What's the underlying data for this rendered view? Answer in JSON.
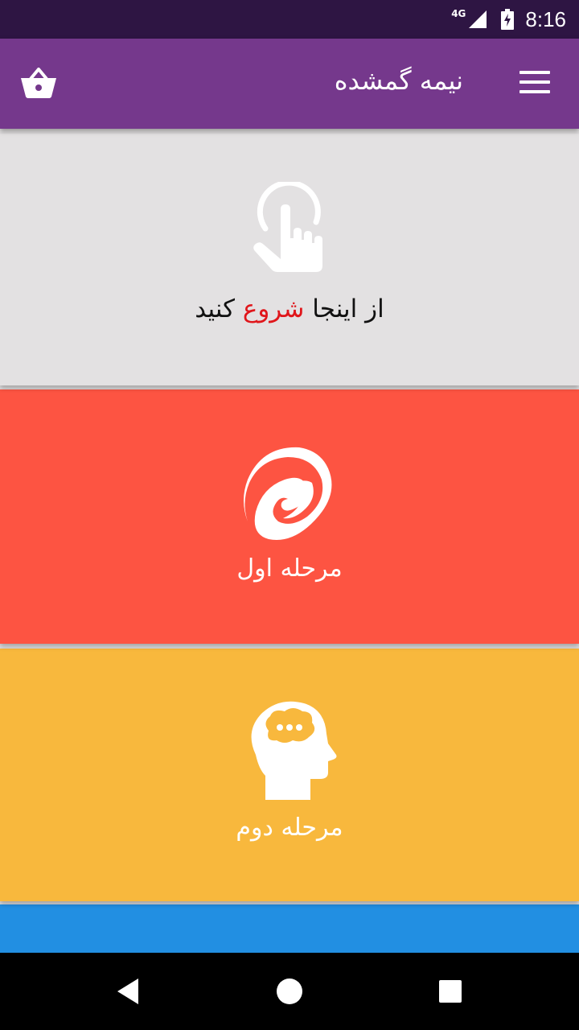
{
  "status_bar": {
    "network": "4G",
    "time": "8:16"
  },
  "app_bar": {
    "title": "نیمه گمشده"
  },
  "start_card": {
    "text_before": "از اینجا ",
    "text_highlight": "شروع",
    "text_after": " کنید",
    "highlight_color": "#e0161b",
    "icon": "touch-hand-icon"
  },
  "stages": [
    {
      "label": "مرحله اول",
      "color": "#fd5442",
      "icon": "swirl-icon"
    },
    {
      "label": "مرحله دوم",
      "color": "#f8b83d",
      "icon": "thinking-head-icon"
    }
  ],
  "colors": {
    "status_bar": "#2e1543",
    "app_bar": "#75388c",
    "start_bg": "#e3e1e2",
    "third_card": "#228fe2"
  }
}
